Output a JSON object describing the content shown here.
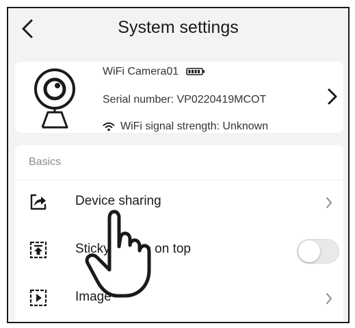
{
  "header": {
    "back_icon": "chevron-left-icon",
    "title": "System settings"
  },
  "device": {
    "icon": "webcam-icon",
    "name": "WiFi Camera01",
    "battery_icon": "battery-icon",
    "serial": "Serial number: VP0220419MCOT",
    "signal_icon": "wifi-icon",
    "signal": "WiFi signal strength: Unknown",
    "chevron_icon": "chevron-right-icon"
  },
  "basics": {
    "label": "Basics",
    "items": [
      {
        "icon": "share-icon",
        "label": "Device sharing",
        "control": "chevron"
      },
      {
        "icon": "pin-to-top-icon",
        "label": "Sticky device on top",
        "control": "toggle",
        "toggle_on": false
      },
      {
        "icon": "play-icon",
        "label": "Image",
        "control": "chevron"
      }
    ]
  },
  "overlay": {
    "icon": "pointing-hand-icon"
  },
  "colors": {
    "background": "#f3f3f3",
    "card": "#ffffff",
    "text": "#1a1a1a",
    "muted": "#8c8c8c"
  }
}
